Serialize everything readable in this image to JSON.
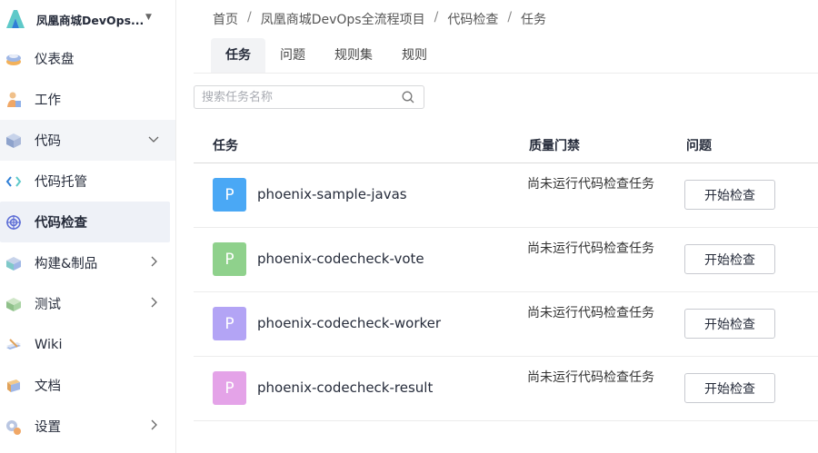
{
  "sidebar": {
    "project_name": "凤凰商城DevOps...",
    "items": [
      {
        "label": "仪表盘",
        "icon": "dashboard-icon"
      },
      {
        "label": "工作",
        "icon": "work-icon"
      },
      {
        "label": "代码",
        "icon": "code-icon"
      },
      {
        "label": "代码托管",
        "icon": "code-hosting-icon"
      },
      {
        "label": "代码检查",
        "icon": "code-check-icon"
      },
      {
        "label": "构建&制品",
        "icon": "build-icon"
      },
      {
        "label": "测试",
        "icon": "test-icon"
      },
      {
        "label": "Wiki",
        "icon": "wiki-icon"
      },
      {
        "label": "文档",
        "icon": "docs-icon"
      },
      {
        "label": "设置",
        "icon": "settings-icon"
      }
    ]
  },
  "breadcrumb": {
    "items": [
      "首页",
      "凤凰商城DevOps全流程项目",
      "代码检查",
      "任务"
    ],
    "separator": "/"
  },
  "tabs": [
    "任务",
    "问题",
    "规则集",
    "规则"
  ],
  "search": {
    "placeholder": "搜索任务名称"
  },
  "table": {
    "headers": [
      "任务",
      "质量门禁",
      "问题"
    ],
    "rows": [
      {
        "avatar": "P",
        "color": "#4aa8f5",
        "name": "phoenix-sample-javas",
        "quality": "尚未运行代码检查任务",
        "action": "开始检查"
      },
      {
        "avatar": "P",
        "color": "#8fd18c",
        "name": "phoenix-codecheck-vote",
        "quality": "尚未运行代码检查任务",
        "action": "开始检查"
      },
      {
        "avatar": "P",
        "color": "#b3a4f5",
        "name": "phoenix-codecheck-worker",
        "quality": "尚未运行代码检查任务",
        "action": "开始检查"
      },
      {
        "avatar": "P",
        "color": "#e4a3e8",
        "name": "phoenix-codecheck-result",
        "quality": "尚未运行代码检查任务",
        "action": "开始检查"
      }
    ]
  }
}
